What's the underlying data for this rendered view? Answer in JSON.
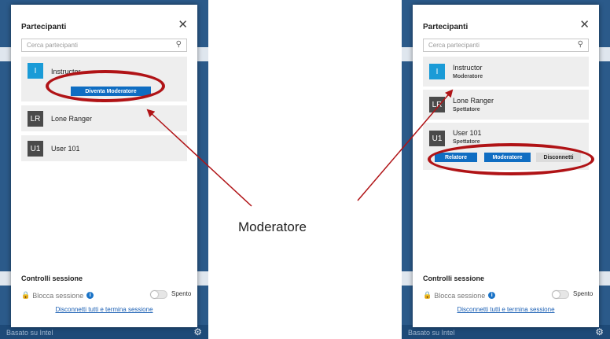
{
  "center_label": "Moderatore",
  "left": {
    "title": "Partecipanti",
    "close_icon": "close-icon",
    "search_placeholder": "Cerca partecipanti",
    "participants": [
      {
        "initials": "I",
        "name": "Instructor",
        "color": "#1a9bd7"
      },
      {
        "initials": "LR",
        "name": "Lone Ranger",
        "color": "#4a4a4a"
      },
      {
        "initials": "U1",
        "name": "User 101",
        "color": "#4a4a4a"
      }
    ],
    "make_moderator_button": "Diventa Moderatore",
    "session_title": "Controlli sessione",
    "lock_label": "Blocca sessione",
    "toggle_label": "Spento",
    "disconnect_all": "Disconnetti tutti e termina sessione",
    "footer_text": "Basato su Intel"
  },
  "right": {
    "title": "Partecipanti",
    "close_icon": "close-icon",
    "search_placeholder": "Cerca partecipanti",
    "participants": [
      {
        "initials": "I",
        "name": "Instructor",
        "role": "Moderatore",
        "color": "#1a9bd7"
      },
      {
        "initials": "LR",
        "name": "Lone Ranger",
        "role": "Spettatore",
        "color": "#4a4a4a"
      },
      {
        "initials": "U1",
        "name": "User 101",
        "role": "Spettatore",
        "color": "#4a4a4a"
      }
    ],
    "buttons": {
      "relatore": "Relatore",
      "moderatore": "Moderatore",
      "disconnetti": "Disconnetti"
    },
    "session_title": "Controlli sessione",
    "lock_label": "Blocca sessione",
    "toggle_label": "Spento",
    "disconnect_all": "Disconnetti tutti e termina sessione",
    "footer_text": "Basato su Intel"
  },
  "colors": {
    "accent_blue": "#0f6dc2",
    "annotation_red": "#b01316"
  }
}
